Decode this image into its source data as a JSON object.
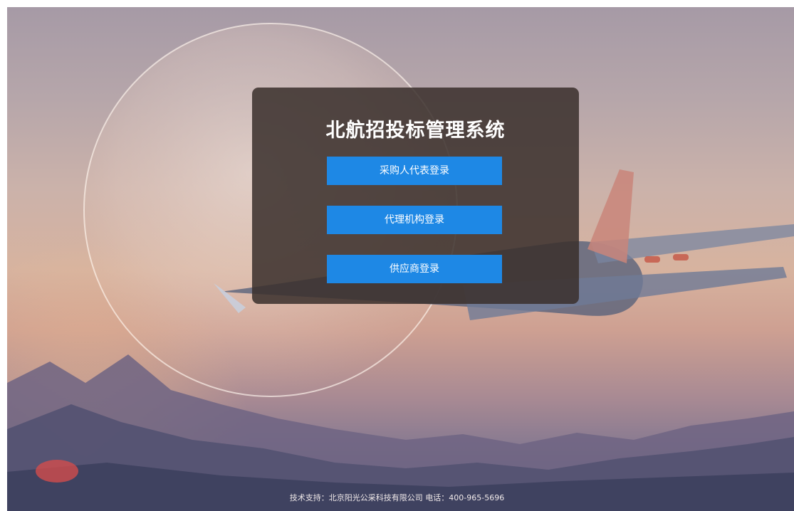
{
  "login": {
    "title": "北航招投标管理系统",
    "buttons": [
      {
        "label": "采购人代表登录"
      },
      {
        "label": "代理机构登录"
      },
      {
        "label": "供应商登录"
      }
    ]
  },
  "footer": {
    "text": "技术支持：北京阳光公采科技有限公司 电话：400-965-5696"
  },
  "colors": {
    "button": "#1e88e5",
    "panel": "#3a302c"
  }
}
